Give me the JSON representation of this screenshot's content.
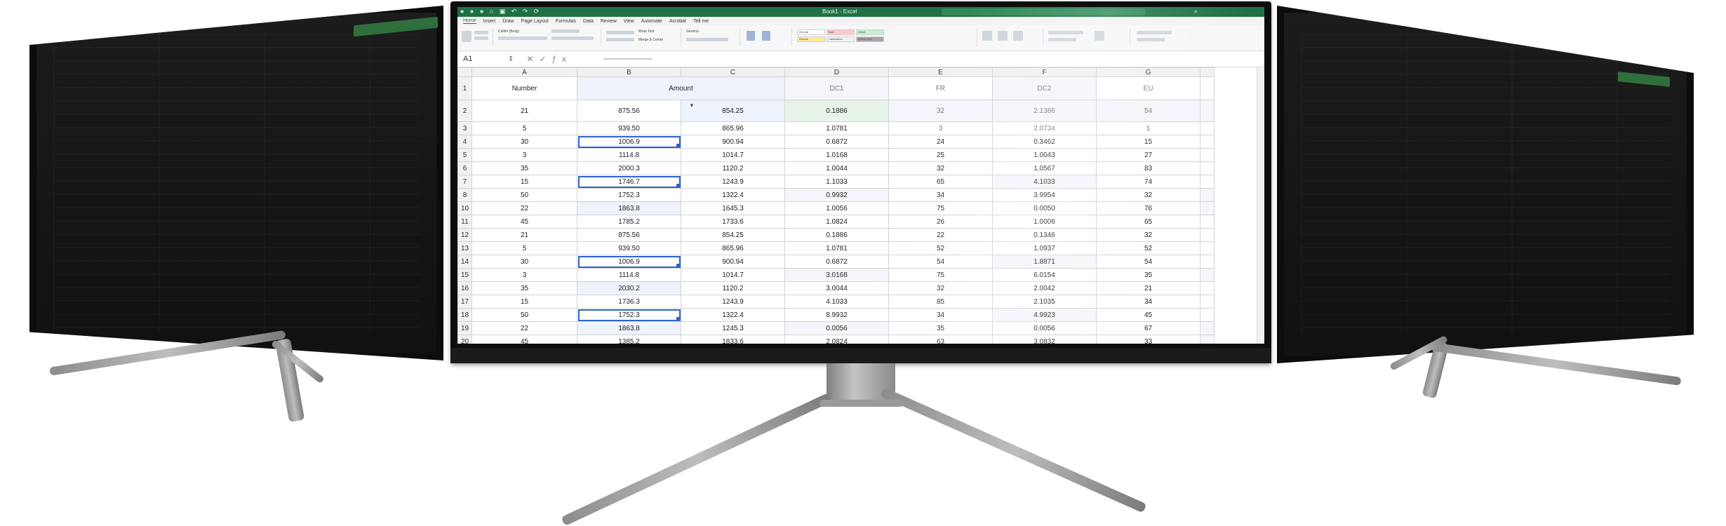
{
  "window": {
    "title": "Book1 - Excel",
    "name_box": "A1"
  },
  "menu_tabs": [
    "Home",
    "Insert",
    "Draw",
    "Page Layout",
    "Formulas",
    "Data",
    "Review",
    "View",
    "Automate",
    "Acrobat",
    "Tell me"
  ],
  "ribbon": {
    "font_name": "Calibri (Body)",
    "number_format": "General",
    "wrap_text": "Wrap Text",
    "merge_center": "Merge & Centre",
    "styles": [
      "Normal",
      "Bad",
      "Good",
      "Neutral",
      "Calculation",
      "Check Cell"
    ]
  },
  "columns": [
    "A",
    "B",
    "C",
    "D",
    "E",
    "F",
    "G"
  ],
  "header_row": {
    "row": "1",
    "cells": [
      "Number",
      "Amount",
      "",
      "DC1",
      "FR",
      "DC2",
      "EU"
    ]
  },
  "rows": [
    {
      "row": "2",
      "cells": [
        "21",
        "875.56",
        "854.25",
        "0.1886",
        "32",
        "2.1386",
        "54"
      ]
    },
    {
      "row": "3",
      "cells": [
        "5",
        "939.50",
        "865.96",
        "1.0781",
        "3",
        "2.0734",
        "1"
      ]
    },
    {
      "row": "4",
      "cells": [
        "30",
        "1006.9",
        "900.94",
        "0.6872",
        "24",
        "0.3462",
        "15"
      ]
    },
    {
      "row": "5",
      "cells": [
        "3",
        "1114.8",
        "1014.7",
        "1.0168",
        "25",
        "1.0043",
        "27"
      ]
    },
    {
      "row": "6",
      "cells": [
        "35",
        "2000.3",
        "1120.2",
        "1.0044",
        "32",
        "1.0567",
        "83"
      ]
    },
    {
      "row": "7",
      "cells": [
        "15",
        "1746.7",
        "1243.9",
        "1.1033",
        "65",
        "4.1033",
        "74"
      ]
    },
    {
      "row": "8",
      "cells": [
        "50",
        "1752.3",
        "1322.4",
        "0.9932",
        "34",
        "3.9954",
        "32"
      ]
    },
    {
      "row": "10",
      "cells": [
        "22",
        "1863.8",
        "1645.3",
        "1.0056",
        "75",
        "0.0050",
        "76"
      ]
    },
    {
      "row": "11",
      "cells": [
        "45",
        "1785.2",
        "1733.6",
        "1.0824",
        "26",
        "1.0006",
        "65"
      ]
    },
    {
      "row": "12",
      "cells": [
        "21",
        "875.56",
        "854.25",
        "0.1886",
        "22",
        "0.1346",
        "32"
      ]
    },
    {
      "row": "13",
      "cells": [
        "5",
        "939.50",
        "865.96",
        "1.0781",
        "52",
        "1.0937",
        "52"
      ]
    },
    {
      "row": "14",
      "cells": [
        "30",
        "1006.9",
        "900.94",
        "0.6872",
        "54",
        "1.8871",
        "54"
      ]
    },
    {
      "row": "15",
      "cells": [
        "3",
        "1114.8",
        "1014.7",
        "3.0168",
        "75",
        "6.0154",
        "35"
      ]
    },
    {
      "row": "16",
      "cells": [
        "35",
        "2030.2",
        "1120.2",
        "3.0044",
        "32",
        "2.0042",
        "21"
      ]
    },
    {
      "row": "17",
      "cells": [
        "15",
        "1736.3",
        "1243.9",
        "4.1033",
        "85",
        "2.1035",
        "34"
      ]
    },
    {
      "row": "18",
      "cells": [
        "50",
        "1752.3",
        "1322.4",
        "8.9932",
        "34",
        "4.9923",
        "45"
      ]
    },
    {
      "row": "19",
      "cells": [
        "22",
        "1863.8",
        "1245.3",
        "0.0056",
        "35",
        "0.0056",
        "67"
      ]
    },
    {
      "row": "20",
      "cells": [
        "45",
        "1385.2",
        "1833.6",
        "2.0824",
        "63",
        "3.0832",
        "33"
      ]
    }
  ],
  "colors": {
    "excel_green": "#1e7145",
    "selection_blue": "#2d63c8",
    "bezel": "#0d0d0d"
  }
}
